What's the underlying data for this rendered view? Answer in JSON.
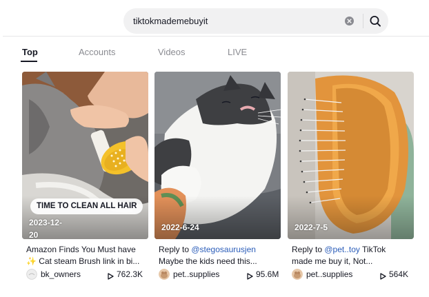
{
  "search": {
    "query": "tiktokmademebuyit"
  },
  "tabs": [
    {
      "label": "Top",
      "active": true
    },
    {
      "label": "Accounts",
      "active": false
    },
    {
      "label": "Videos",
      "active": false
    },
    {
      "label": "LIVE",
      "active": false
    }
  ],
  "results": [
    {
      "date_line1": "2023-12-",
      "date_line2": "20",
      "overlay_caption": "TIME TO CLEAN ALL HAIR",
      "desc_line1": "Amazon Finds You Must have",
      "desc_line2": "✨ Cat steam Brush link in bi...",
      "username": "bk_owners",
      "views": "762.3K"
    },
    {
      "date": "2022-6-24",
      "desc_prefix": "Reply to ",
      "desc_mention": "@stegosaurusjen",
      "desc_line2": "Maybe the kids need this...",
      "username": "pet..supplies",
      "views": "95.6M"
    },
    {
      "date": "2022-7-5",
      "desc_prefix": "Reply to ",
      "desc_mention": "@pet..toy",
      "desc_suffix": " TikTok",
      "desc_line2": "made me buy it, Not...",
      "username": "pet..supplies",
      "views": "564K"
    }
  ],
  "colors": {
    "mention": "#2b5db9",
    "text": "#161823",
    "muted_tab": "#8a8b91",
    "search_bg": "#f1f1f2"
  },
  "icons": [
    "clear-icon",
    "search-icon",
    "play-icon"
  ]
}
